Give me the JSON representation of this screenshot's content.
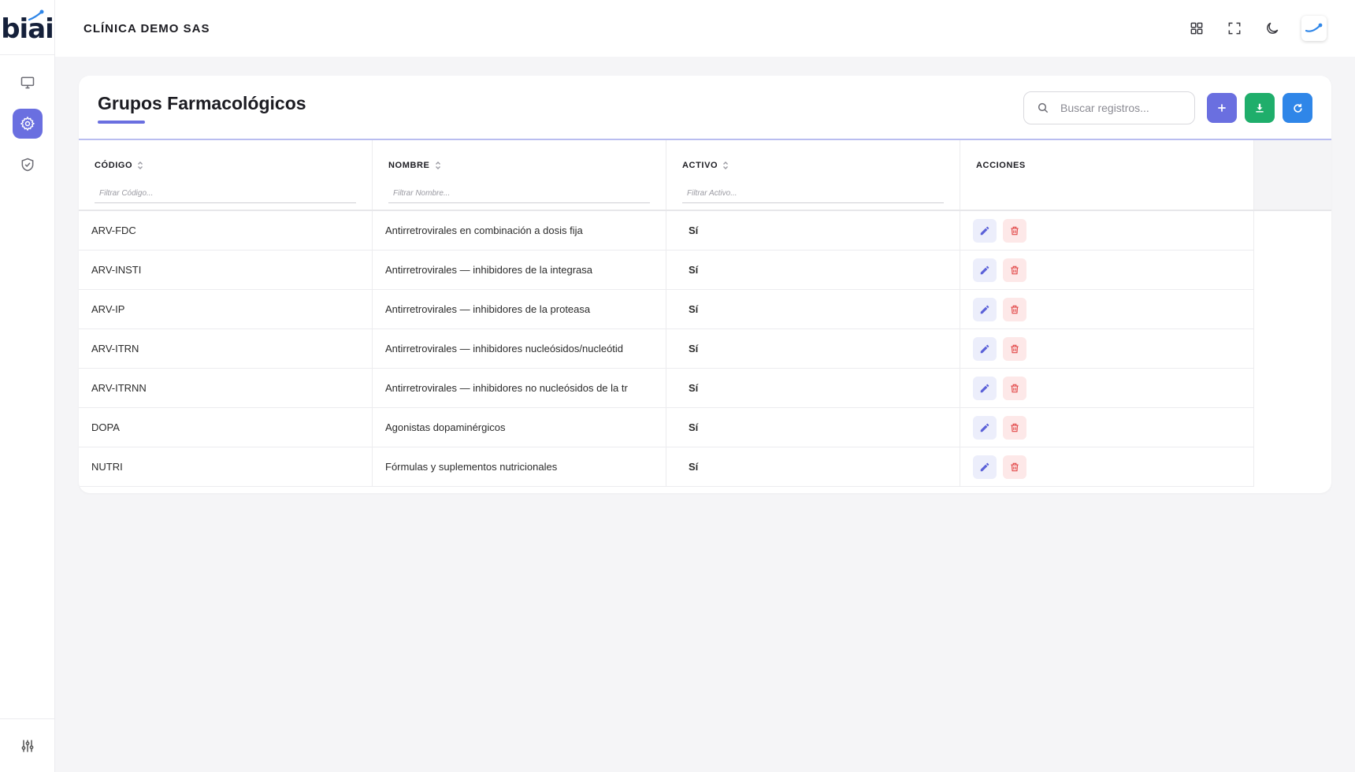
{
  "brand": {
    "logo_text": "biai"
  },
  "header": {
    "title": "CLÍNICA DEMO SAS"
  },
  "page": {
    "title": "Grupos Farmacológicos"
  },
  "search": {
    "placeholder": "Buscar registros..."
  },
  "table": {
    "columns": [
      {
        "label": "CÓDIGO",
        "filter_placeholder": "Filtrar Código..."
      },
      {
        "label": "NOMBRE",
        "filter_placeholder": "Filtrar Nombre..."
      },
      {
        "label": "ACTIVO",
        "filter_placeholder": "Filtrar Activo..."
      },
      {
        "label": "ACCIONES"
      }
    ],
    "rows": [
      {
        "codigo": "ARV-FDC",
        "nombre": "Antirretrovirales en combinación a dosis fija",
        "activo": "Sí"
      },
      {
        "codigo": "ARV-INSTI",
        "nombre": "Antirretrovirales — inhibidores de la integrasa",
        "activo": "Sí"
      },
      {
        "codigo": "ARV-IP",
        "nombre": "Antirretrovirales — inhibidores de la proteasa",
        "activo": "Sí"
      },
      {
        "codigo": "ARV-ITRN",
        "nombre": "Antirretrovirales — inhibidores nucleósidos/nucleótid",
        "activo": "Sí"
      },
      {
        "codigo": "ARV-ITRNN",
        "nombre": "Antirretrovirales — inhibidores no nucleósidos de la tr",
        "activo": "Sí"
      },
      {
        "codigo": "DOPA",
        "nombre": "Agonistas dopaminérgicos",
        "activo": "Sí"
      },
      {
        "codigo": "NUTRI",
        "nombre": "Fórmulas y suplementos nutricionales",
        "activo": "Sí"
      }
    ]
  },
  "icons": {
    "sidebar": [
      "monitor-icon",
      "gear-icon",
      "shield-check-icon"
    ],
    "sidebar_bottom": "sliders-icon",
    "header": [
      "grid-icon",
      "fullscreen-icon",
      "moon-icon"
    ],
    "toolbar": [
      "plus-icon",
      "download-icon",
      "refresh-icon"
    ],
    "row_actions": [
      "pencil-icon",
      "trash-icon"
    ]
  },
  "colors": {
    "primary": "#6a6fe0",
    "export": "#1fae6b",
    "refresh": "#2f86e8",
    "delete": "#e24a4a"
  }
}
